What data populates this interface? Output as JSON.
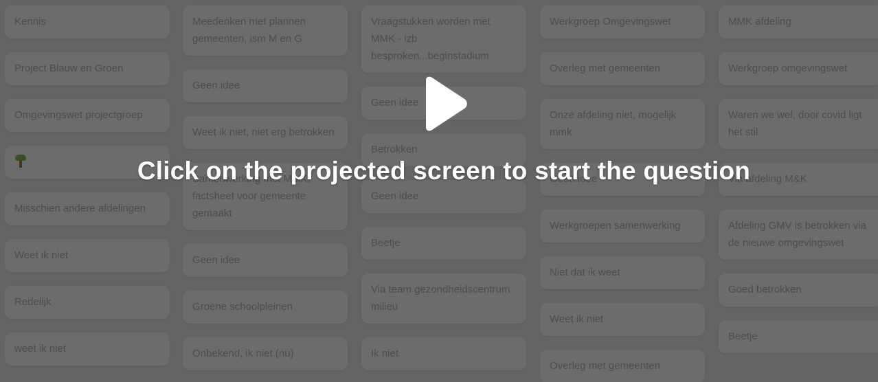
{
  "columns": [
    {
      "cards": [
        {
          "text": "Kennis"
        },
        {
          "text": "Project Blauw en Groen"
        },
        {
          "text": "Omgevingswet projectgroep"
        },
        {
          "text": ""
        },
        {
          "text": "Misschien andere afdelingen"
        },
        {
          "text": "Weet ik niet"
        },
        {
          "text": "Redelijk"
        },
        {
          "text": "weet ik niet"
        }
      ]
    },
    {
      "cards": [
        {
          "text": "Meedenken met plannen gemeenten, ism M en G"
        },
        {
          "text": "Geen idee"
        },
        {
          "text": "Weet ik niet, niet erg betrokken"
        },
        {
          "text": "Samenwerking met MMK, factsheet voor gemeente gemaakt"
        },
        {
          "text": "Geen idee"
        },
        {
          "text": "Groene schoolpleinen"
        },
        {
          "text": "Onbekend, ik niet (nu)"
        }
      ]
    },
    {
      "cards": [
        {
          "text": "Vraagstukken worden met MMK - izb besproken...beginstadium"
        },
        {
          "text": "Geen idee"
        },
        {
          "text": "Betrokken"
        },
        {
          "text": "Geen idee"
        },
        {
          "text": "Beetje"
        },
        {
          "text": "Via team gezondheidscentrum milieu"
        },
        {
          "text": "Ik niet"
        }
      ]
    },
    {
      "cards": [
        {
          "text": "Werkgroep Omgevingswet"
        },
        {
          "text": "Overleg met gemeenten"
        },
        {
          "text": "Onze afdeling niet, mogelijk mmk"
        },
        {
          "text": "Geen idee"
        },
        {
          "text": "Werkgroepen samenwerking"
        },
        {
          "text": "Niet dat ik weet"
        },
        {
          "text": "Weet ik niet"
        },
        {
          "text": "Overleg met gemeenten"
        }
      ]
    },
    {
      "cards": [
        {
          "text": "MMK afdeling"
        },
        {
          "text": "Werkgroep omgevingswet"
        },
        {
          "text": "Waren we wel, door covid ligt het stil"
        },
        {
          "text": "Via afdeling M&K"
        },
        {
          "text": "Afdeling GMV is betrokken via de nieuwe omgevingswet"
        },
        {
          "text": "Goed betrokken"
        },
        {
          "text": "Beetje"
        }
      ]
    }
  ],
  "overlay": {
    "prompt": "Click on the projected screen to start the question",
    "play_icon": "play-icon"
  },
  "colors": {
    "card_bg": "#7c7c7c",
    "card_text": "#565656",
    "prompt_text": "#ffffff"
  }
}
